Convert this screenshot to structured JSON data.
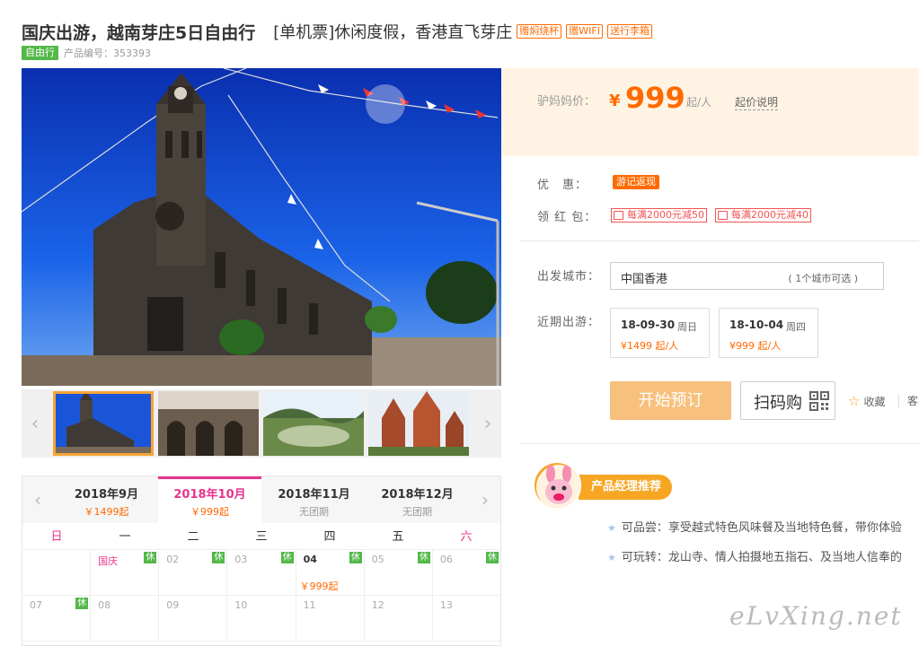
{
  "header": {
    "title": "国庆出游，越南芽庄5日自由行",
    "subtitle": "[单机票]休闲度假，香港直飞芽庄",
    "tags": [
      "赠焖烧杯",
      "赠WIFI",
      "送行李箱"
    ],
    "badge": "自由行",
    "product_code": "产品编号：353393"
  },
  "gallery": {
    "prev_icon": "chevron-left-icon",
    "next_icon": "chevron-right-icon",
    "thumb_count": 4,
    "active_thumb": 0
  },
  "calendar": {
    "months": [
      {
        "name": "2018年9月",
        "price": "￥1499起"
      },
      {
        "name": "2018年10月",
        "price": "￥999起"
      },
      {
        "name": "2018年11月",
        "price": "无团期"
      },
      {
        "name": "2018年12月",
        "price": "无团期"
      }
    ],
    "active_month": 1,
    "weekdays": [
      "日",
      "一",
      "二",
      "三",
      "四",
      "五",
      "六"
    ],
    "rows": [
      [
        {
          "d": ""
        },
        {
          "d": "国庆",
          "holiday": true,
          "rest": "休"
        },
        {
          "d": "02",
          "rest": "休"
        },
        {
          "d": "03",
          "rest": "休"
        },
        {
          "d": "04",
          "avail": true,
          "rest": "休",
          "price": "￥999起"
        },
        {
          "d": "05",
          "rest": "休"
        },
        {
          "d": "06",
          "rest": "休"
        }
      ],
      [
        {
          "d": "07",
          "rest": "休"
        },
        {
          "d": "08"
        },
        {
          "d": "09"
        },
        {
          "d": "10"
        },
        {
          "d": "11"
        },
        {
          "d": "12"
        },
        {
          "d": "13"
        }
      ]
    ],
    "rest_label": "休"
  },
  "price": {
    "label": "驴妈妈价：",
    "currency": "¥",
    "amount": "999",
    "unit": "起/人",
    "explain": "起价说明"
  },
  "promo": {
    "discount_label": "优　惠：",
    "discount_tag": "游记返现",
    "coupon_label": "领 红 包：",
    "coupons": [
      "每满2000元减50",
      "每满2000元减40"
    ]
  },
  "departure": {
    "label": "出发城市：",
    "city": "中国香港",
    "extra": "( 1个城市可选 )"
  },
  "recent": {
    "label": "近期出游：",
    "dates": [
      {
        "date": "18-09-30",
        "week": "周日",
        "price": "¥1499 起/人"
      },
      {
        "date": "18-10-04",
        "week": "周四",
        "price": "¥999 起/人"
      }
    ]
  },
  "actions": {
    "book": "开始预订",
    "scan": "扫码购",
    "favorite": "收藏",
    "share_cut": "客"
  },
  "recommend": {
    "badge": "产品经理推荐",
    "items": [
      "可品尝：享受越式特色风味餐及当地特色餐，带你体验",
      "可玩转：龙山寺、情人拍摄地五指石、及当地人信奉的"
    ]
  },
  "watermark": "eLvXing.net",
  "colors": {
    "accent": "#ff6a00",
    "pink": "#e8348d",
    "green": "#53b849",
    "book_button": "#f7c07c"
  }
}
